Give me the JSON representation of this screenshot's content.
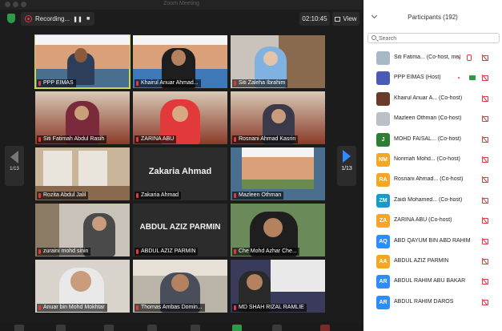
{
  "window": {
    "title": "Zoom Meeting"
  },
  "recording": {
    "label": "Recording..."
  },
  "clock": "02:10:45",
  "view_label": "View",
  "pagination": {
    "left": "1/13",
    "right": "1/13"
  },
  "participants_panel": {
    "title": "Participants (192)",
    "search_placeholder": "Search"
  },
  "colors": {
    "accent": "#2d8cff",
    "recording": "#e0393e",
    "speaking_border": "#c8d94a"
  },
  "tiles": [
    {
      "name": "PPP EIMAS",
      "speaking": true
    },
    {
      "name": "Khairul Anuar Ahmad..."
    },
    {
      "name": "Siti Zaleha Ibrahim"
    },
    {
      "name": "Siti Fatimah Abdul Rasih"
    },
    {
      "name": "ZARINA ABU"
    },
    {
      "name": "Rosnani Ahmad Kasrin"
    },
    {
      "name": "Rozita Abdul Jalil"
    },
    {
      "name": "Zakaria Ahmad",
      "center": "Zakaria Ahmad"
    },
    {
      "name": "Mazleen Othman"
    },
    {
      "name": "zuraini mohd sinin"
    },
    {
      "name": "ABDUL AZIZ PARMIN",
      "center": "ABDUL AZIZ PARMIN"
    },
    {
      "name": "Che Mohd Azhar Che..."
    },
    {
      "name": "Anuar bin Mohd Mokhtar"
    },
    {
      "name": "Thomas Ambas Domin..."
    },
    {
      "name": "MD SHAH RIZAL RAMLIE"
    }
  ],
  "participants": [
    {
      "initials": "",
      "name": "Siti Fatima... (Co-host, me)",
      "avatar_color": "#a9b7c9",
      "icon": "photo"
    },
    {
      "initials": "",
      "name": "PPP EIMAS (Host)",
      "avatar_color": "#4a5bb7",
      "icon": "photo"
    },
    {
      "initials": "",
      "name": "Khairul Anuar A... (Co-host)",
      "avatar_color": "#6b3b2a",
      "icon": "photo"
    },
    {
      "initials": "",
      "name": "Mazleen Othman (Co-host)",
      "avatar_color": "#b9c0c8",
      "icon": "photo"
    },
    {
      "initials": "J",
      "name": "MOHD FAISAL... (Co-host)",
      "avatar_color": "#2e7d32"
    },
    {
      "initials": "NM",
      "name": "Norimah Mohd... (Co-host)",
      "avatar_color": "#f5a623"
    },
    {
      "initials": "RA",
      "name": "Rosnani Ahmad... (Co-host)",
      "avatar_color": "#f5a623"
    },
    {
      "initials": "ZM",
      "name": "Zaidi Mohamed... (Co-host)",
      "avatar_color": "#2196c9"
    },
    {
      "initials": "ZA",
      "name": "ZARINA ABU (Co-host)",
      "avatar_color": "#f5a623"
    },
    {
      "initials": "AQ",
      "name": "ABD QAYUM BIN ABD RAHIM",
      "avatar_color": "#2d8cff"
    },
    {
      "initials": "AA",
      "name": "ABDUL AZIZ PARMIN",
      "avatar_color": "#f5a623"
    },
    {
      "initials": "AR",
      "name": "ABDUL RAHIM ABU BAKAR",
      "avatar_color": "#2d8cff"
    },
    {
      "initials": "AR",
      "name": "ABDUL RAHIM DAROS",
      "avatar_color": "#2d8cff"
    }
  ]
}
